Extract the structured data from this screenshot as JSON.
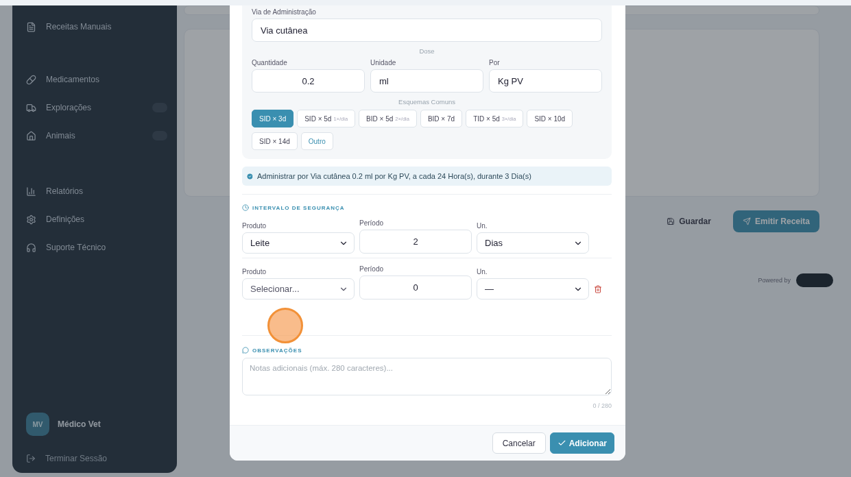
{
  "sidebar": {
    "items": [
      {
        "label": "Receitas Manuais",
        "badge": false
      },
      {
        "label": "Medicamentos",
        "badge": false
      },
      {
        "label": "Explorações",
        "badge": true
      },
      {
        "label": "Animais",
        "badge": true
      },
      {
        "label": "Relatórios",
        "badge": false
      },
      {
        "label": "Definições",
        "badge": false
      },
      {
        "label": "Suporte Técnico",
        "badge": false
      }
    ],
    "user": {
      "initials": "MV",
      "name": "Médico Vet"
    },
    "logout": "Terminar Sessão"
  },
  "background": {
    "buttons": [
      {
        "kind": "ghost",
        "label": "Guardar"
      },
      {
        "kind": "primary",
        "label": "Emitir Receita"
      }
    ],
    "powered_by": "Powered by"
  },
  "modal": {
    "route": {
      "label": "Via de Administração",
      "value": "Via cutânea"
    },
    "dose": {
      "title": "Dose",
      "fields": [
        {
          "label": "Quantidade",
          "value": "0.2"
        },
        {
          "label": "Unidade",
          "value": "ml"
        },
        {
          "label": "Por",
          "value": "Kg PV"
        }
      ]
    },
    "schemes": {
      "title": "Esquemas Comuns",
      "chips": [
        {
          "label": "SID × 3d",
          "selected": true,
          "kind": "preset"
        },
        {
          "label": "SID × 5d",
          "note": "1×/dia",
          "selected": false,
          "kind": "preset"
        },
        {
          "label": "BID × 5d",
          "note": "2×/dia",
          "selected": false,
          "kind": "preset"
        },
        {
          "label": "BID × 7d",
          "selected": false,
          "kind": "preset"
        },
        {
          "label": "TID × 5d",
          "note": "3×/dia",
          "selected": false,
          "kind": "preset"
        },
        {
          "label": "SID × 10d",
          "selected": false,
          "kind": "preset"
        },
        {
          "label": "SID × 14d",
          "selected": false,
          "kind": "preset"
        },
        {
          "label": "Outro",
          "selected": false,
          "kind": "other"
        }
      ]
    },
    "summary": "Administrar por Via cutânea 0.2 ml por Kg PV, a cada 24 Hora(s), durante 3 Dia(s)",
    "safety": {
      "title": "INTERVALO DE SEGURANÇA",
      "rows": [
        {
          "product_label": "Produto",
          "product": "Leite",
          "period_label": "Período",
          "period": "2",
          "unit_label": "Un.",
          "unit": "Dias",
          "removable": false
        },
        {
          "product_label": "Produto",
          "product": "Selecionar...",
          "period_label": "Período",
          "period": "0",
          "unit_label": "Un.",
          "unit": "—",
          "removable": true
        }
      ]
    },
    "notes": {
      "title": "OBSERVAÇÕES",
      "placeholder": "Notas adicionais (máx. 280 caracteres)...",
      "counter": "0 / 280"
    },
    "buttons": [
      {
        "kind": "secondary",
        "label": "Cancelar"
      },
      {
        "kind": "primary",
        "label": "Adicionar"
      }
    ]
  }
}
